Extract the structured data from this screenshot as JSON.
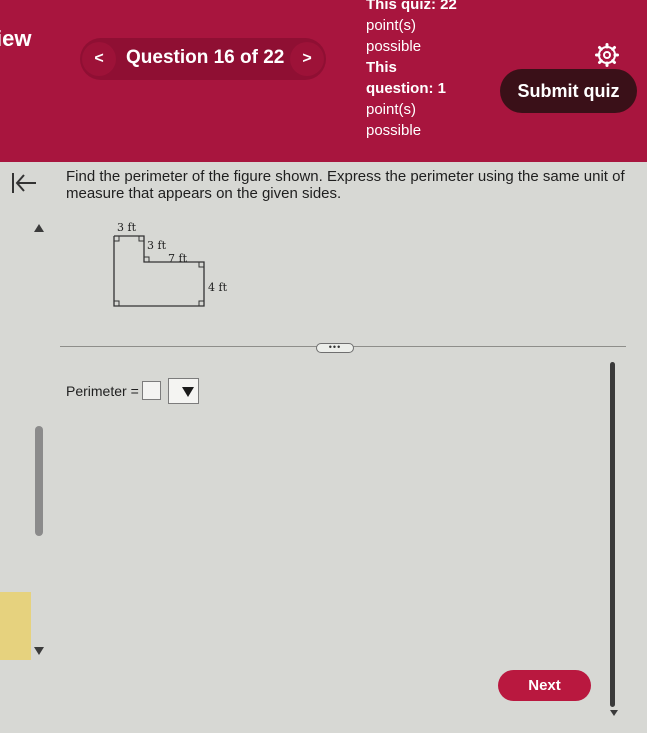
{
  "header": {
    "left_fragment": "iew",
    "prev_label": "<",
    "next_label": ">",
    "question_label": "Question 16 of 22",
    "points_lines": [
      "This quiz: 22",
      "point(s)",
      "possible",
      "This",
      "question: 1",
      "point(s)",
      "possible"
    ],
    "submit_label": "Submit quiz",
    "gear_icon": "gear-icon"
  },
  "question": {
    "text": "Find the perimeter of the figure shown.  Express the perimeter using the same unit of measure that appears on the given sides.",
    "figure_labels": [
      "3 ft",
      "3 ft",
      "7 ft",
      "4 ft"
    ]
  },
  "divider": {
    "dots_label": "•••"
  },
  "answer": {
    "perimeter_label": "Perimeter =",
    "value": "",
    "unit_selected": ""
  },
  "footer": {
    "next_label": "Next"
  },
  "colors": {
    "header_bg": "#a8153e",
    "submit_bg": "#3a1018",
    "next_bg": "#b9183f",
    "content_bg": "#d7d8d4"
  }
}
